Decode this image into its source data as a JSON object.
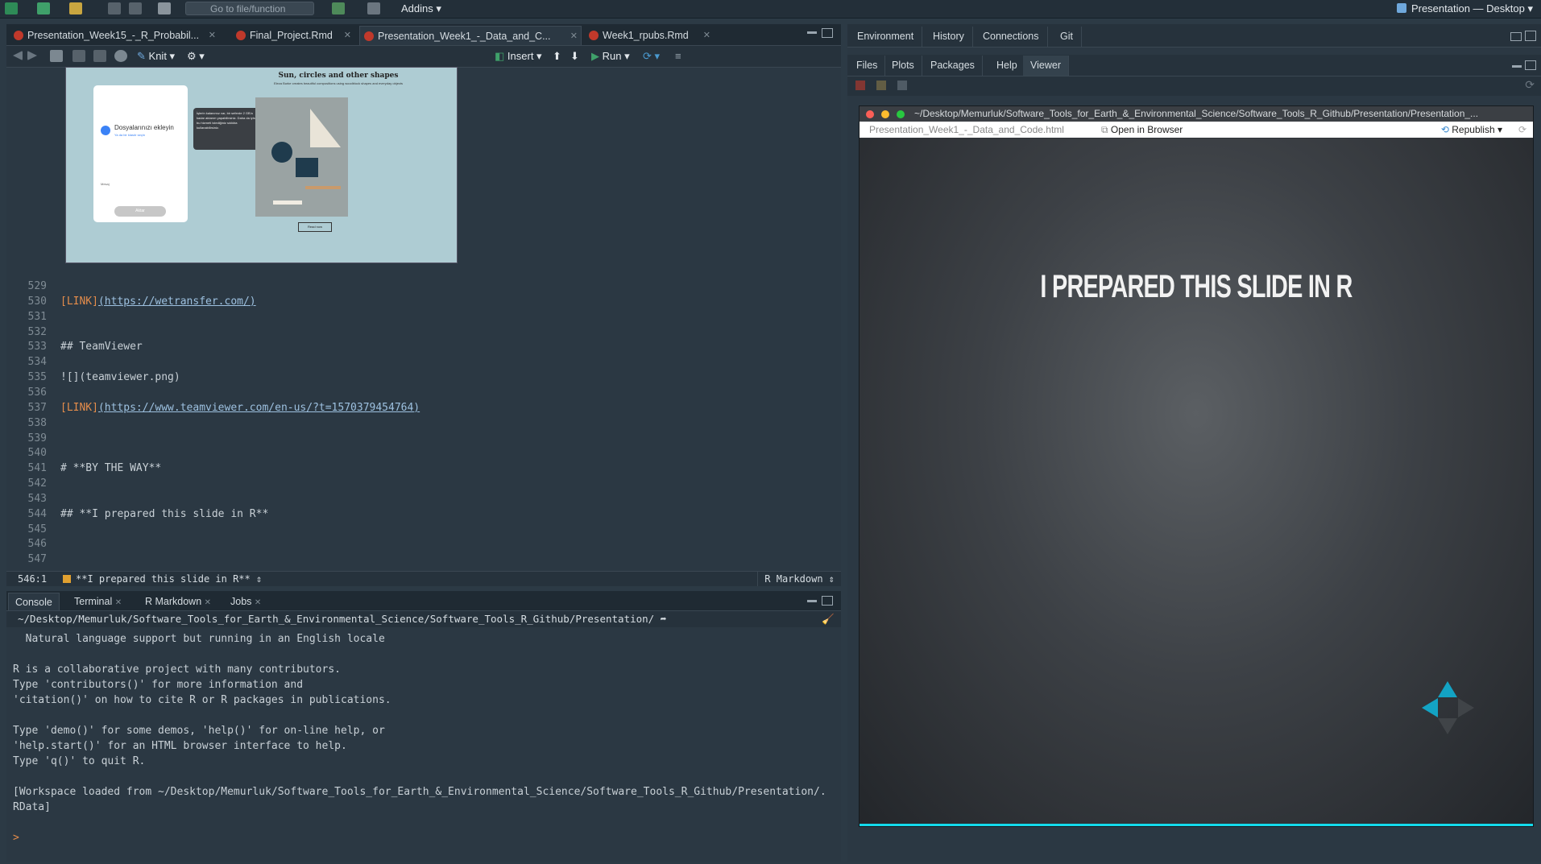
{
  "toolbar": {
    "goto_placeholder": "Go to file/function",
    "addins": "Addins",
    "project": "Presentation — Desktop"
  },
  "editor": {
    "tabs": [
      {
        "label": "Presentation_Week15_-_R_Probabil..."
      },
      {
        "label": "Final_Project.Rmd"
      },
      {
        "label": "Presentation_Week1_-_Data_and_C..."
      },
      {
        "label": "Week1_rpubs.Rmd"
      }
    ],
    "knit": "Knit",
    "insert": "Insert",
    "run": "Run",
    "embedded_image": {
      "heading": "Sun, circles and other shapes",
      "subheading": "Eleza Burke creates beautiful compositions using woodblock shapes and everyday objects",
      "dialog_title": "Dosyalarınızı ekleyin",
      "dialog_sub": "Ya da bir klasör seçin",
      "message_label": "Mesaj",
      "send_button": "Aktar",
      "tooltip": "İşlerin kalanımız var, bir seferde 2 GB'a kadar aktarım yapabilirsiniz. Daha da iyisi, bu hizmeti istediğiniz sıklıkta kullanabilirsiniz.",
      "read_more": "Read now"
    },
    "lines": [
      {
        "n": "529",
        "text": ""
      },
      {
        "n": "530",
        "link": "[LINK]",
        "url": "(https://wetransfer.com/)"
      },
      {
        "n": "531",
        "text": ""
      },
      {
        "n": "532",
        "text": ""
      },
      {
        "n": "533",
        "text": "## TeamViewer"
      },
      {
        "n": "534",
        "text": ""
      },
      {
        "n": "535",
        "text": "![](teamviewer.png)"
      },
      {
        "n": "536",
        "text": ""
      },
      {
        "n": "537",
        "link": "[LINK]",
        "url": "(https://www.teamviewer.com/en-us/?t=1570379454764)"
      },
      {
        "n": "538",
        "text": ""
      },
      {
        "n": "539",
        "text": ""
      },
      {
        "n": "540",
        "text": ""
      },
      {
        "n": "541",
        "text": "# **BY THE WAY**"
      },
      {
        "n": "542",
        "text": ""
      },
      {
        "n": "543",
        "text": ""
      },
      {
        "n": "544",
        "text": "## **I prepared this slide in R**"
      },
      {
        "n": "545",
        "text": ""
      },
      {
        "n": "546",
        "text": ""
      },
      {
        "n": "547",
        "text": ""
      }
    ],
    "status_pos": "546:1",
    "status_section": "**I prepared this slide in R**",
    "status_mode": "R Markdown"
  },
  "console": {
    "tabs": [
      "Console",
      "Terminal",
      "R Markdown",
      "Jobs"
    ],
    "path": "~/Desktop/Memurluk/Software_Tools_for_Earth_&_Environmental_Science/Software_Tools_R_Github/Presentation/",
    "lines": [
      "  Natural language support but running in an English locale",
      "",
      "R is a collaborative project with many contributors.",
      "Type 'contributors()' for more information and",
      "'citation()' on how to cite R or R packages in publications.",
      "",
      "Type 'demo()' for some demos, 'help()' for on-line help, or",
      "'help.start()' for an HTML browser interface to help.",
      "Type 'q()' to quit R.",
      "",
      "[Workspace loaded from ~/Desktop/Memurluk/Software_Tools_for_Earth_&_Environmental_Science/Software_Tools_R_Github/Presentation/.",
      "RData]",
      "",
      ">"
    ]
  },
  "right": {
    "top_tabs": [
      "Environment",
      "History",
      "Connections",
      "Git"
    ],
    "bottom_tabs": [
      "Files",
      "Plots",
      "Packages",
      "Help",
      "Viewer"
    ],
    "viewer_title": "~/Desktop/Memurluk/Software_Tools_for_Earth_&_Environmental_Science/Software_Tools_R_Github/Presentation/Presentation_...",
    "viewer_file": "Presentation_Week1_-_Data_and_Code.html",
    "open_in_browser": "Open in Browser",
    "republish": "Republish",
    "slide_title": "I PREPARED THIS SLIDE IN R"
  }
}
